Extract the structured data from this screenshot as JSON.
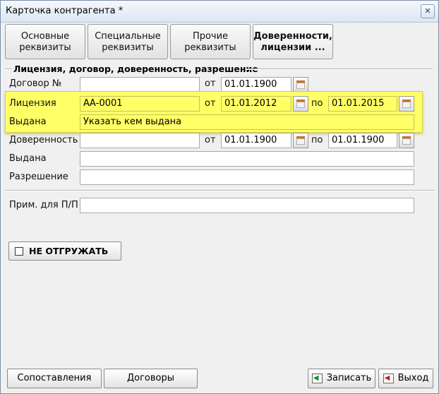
{
  "window": {
    "title": "Карточка контрагента *",
    "close_glyph": "✕"
  },
  "tabs": [
    {
      "line1": "Основные",
      "line2": "реквизиты"
    },
    {
      "line1": "Специальные",
      "line2": "реквизиты"
    },
    {
      "line1": "Прочие",
      "line2": "реквизиты"
    },
    {
      "line1": "Доверенности,",
      "line2": "лицензии ..."
    }
  ],
  "section": {
    "title": "Лицензия, договор, доверенность, разрешение"
  },
  "contract": {
    "label": "Договор №",
    "number": "",
    "from_label": "от",
    "from_date": "01.01.1900"
  },
  "license": {
    "label": "Лицензия",
    "number": "АА-0001",
    "from_label": "от",
    "from_date": "01.01.2012",
    "to_label": "по",
    "to_date": "01.01.2015",
    "issued_label": "Выдана",
    "issued_by": "Указать кем выдана"
  },
  "poa": {
    "label": "Доверенность",
    "number": "",
    "from_label": "от",
    "from_date": "01.01.1900",
    "to_label": "по",
    "to_date": "01.01.1900",
    "issued_label": "Выдана",
    "issued_by": ""
  },
  "permit": {
    "label": "Разрешение",
    "value": ""
  },
  "note": {
    "label": "Прим. для П/П",
    "value": ""
  },
  "no_ship": {
    "label": "НЕ ОТГРУЖАТЬ",
    "checked": false
  },
  "buttons": {
    "mapping": "Сопоставления",
    "contracts": "Договоры",
    "save": "Записать",
    "exit": "Выход"
  },
  "icons": {
    "calendar": "calendar-icon",
    "save": "save-icon",
    "exit": "exit-icon"
  }
}
